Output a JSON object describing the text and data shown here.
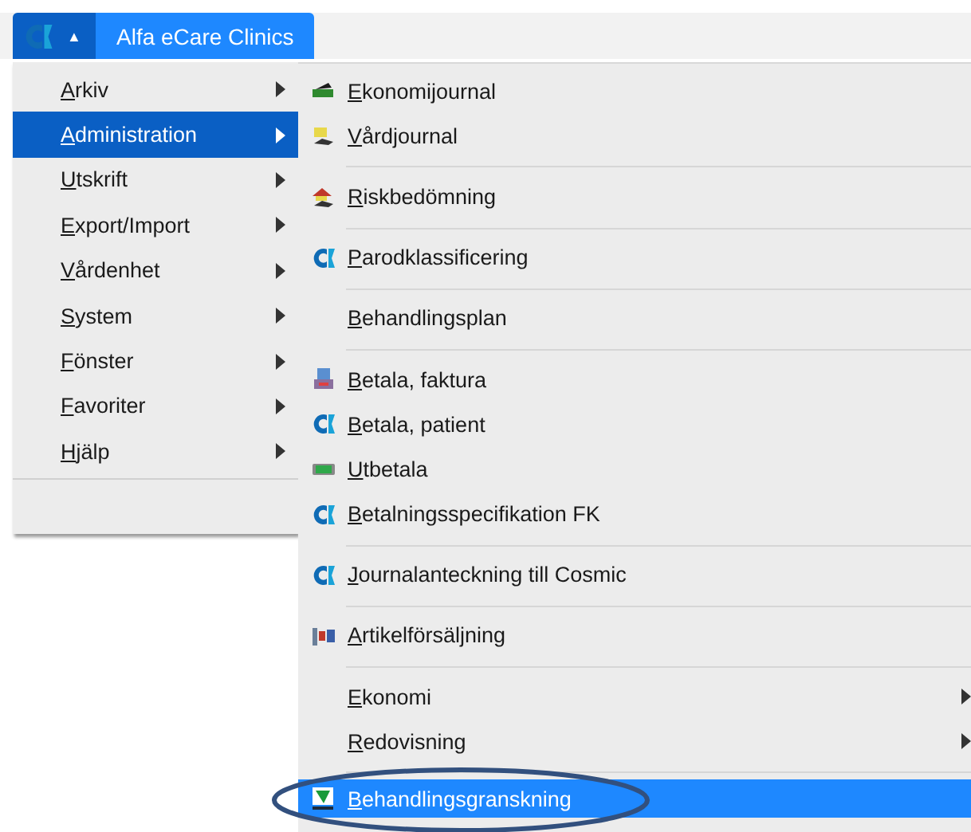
{
  "app_button": {
    "symbol": "▲"
  },
  "tab": {
    "label": "Alfa eCare Clinics"
  },
  "main_menu": [
    {
      "label": "Arkiv",
      "selected": false,
      "has_submenu": true
    },
    {
      "label": "Administration",
      "selected": true,
      "has_submenu": true
    },
    {
      "label": "Utskrift",
      "selected": false,
      "has_submenu": true
    },
    {
      "label": "Export/Import",
      "selected": false,
      "has_submenu": true
    },
    {
      "label": "Vårdenhet",
      "selected": false,
      "has_submenu": true
    },
    {
      "label": "System",
      "selected": false,
      "has_submenu": true
    },
    {
      "label": "Fönster",
      "selected": false,
      "has_submenu": true
    },
    {
      "label": "Favoriter",
      "selected": false,
      "has_submenu": true
    },
    {
      "label": "Hjälp",
      "selected": false,
      "has_submenu": true
    }
  ],
  "submenu": [
    {
      "kind": "ledger",
      "label": "Ekonomijournal",
      "selected": false,
      "has_submenu": false
    },
    {
      "kind": "chart",
      "label": "Vårdjournal",
      "selected": false,
      "has_submenu": false
    },
    {
      "kind": "separator"
    },
    {
      "kind": "risk",
      "label": "Riskbedömning",
      "selected": false,
      "has_submenu": false
    },
    {
      "kind": "separator"
    },
    {
      "kind": "alfa",
      "label": "Parodklassificering",
      "selected": false,
      "has_submenu": false
    },
    {
      "kind": "separator"
    },
    {
      "kind": "plain",
      "label": "Behandlingsplan",
      "selected": false,
      "has_submenu": false
    },
    {
      "kind": "separator"
    },
    {
      "kind": "invoice",
      "label": "Betala, faktura",
      "selected": false,
      "has_submenu": false
    },
    {
      "kind": "alfa",
      "label": "Betala, patient",
      "selected": false,
      "has_submenu": false
    },
    {
      "kind": "cash",
      "label": "Utbetala",
      "selected": false,
      "has_submenu": false
    },
    {
      "kind": "alfa",
      "label": "Betalningsspecifikation FK",
      "selected": false,
      "has_submenu": false
    },
    {
      "kind": "separator"
    },
    {
      "kind": "alfa",
      "label": "Journalanteckning till Cosmic",
      "selected": false,
      "has_submenu": false
    },
    {
      "kind": "separator"
    },
    {
      "kind": "goods",
      "label": "Artikelförsäljning",
      "selected": false,
      "has_submenu": false
    },
    {
      "kind": "separator"
    },
    {
      "kind": "plain",
      "label": "Ekonomi",
      "selected": false,
      "has_submenu": true
    },
    {
      "kind": "plain",
      "label": "Redovisning",
      "selected": false,
      "has_submenu": true
    },
    {
      "kind": "separator"
    },
    {
      "kind": "review",
      "label": "Behandlingsgranskning",
      "selected": true,
      "has_submenu": false,
      "circled": true
    }
  ]
}
